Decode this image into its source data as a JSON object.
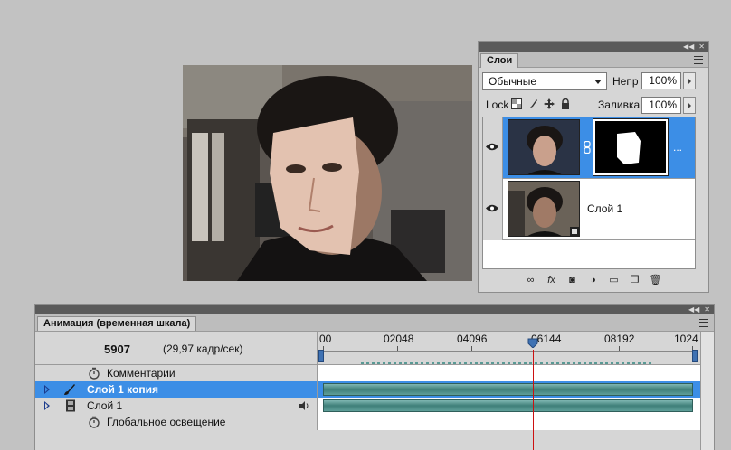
{
  "layers_panel": {
    "title": "Слои",
    "blend_mode": "Обычные",
    "opacity_label": "Непр",
    "opacity_value": "100%",
    "lock_label": "Lock",
    "fill_label": "Заливка",
    "fill_value": "100%",
    "layers": [
      {
        "name": "",
        "selected": true,
        "has_mask": true,
        "overflow_text": "..."
      },
      {
        "name": "Слой 1",
        "selected": false,
        "has_mask": false
      }
    ],
    "bottom_icons": [
      "link-layers-icon",
      "fx-icon",
      "add-mask-icon",
      "adjustment-icon",
      "group-folder-icon",
      "new-layer-icon",
      "trash-icon"
    ]
  },
  "animation_panel": {
    "title": "Анимация (временная шкала)",
    "current_frame": "5907",
    "fps": "(29,97 кадр/сек)",
    "ruler_labels": [
      "00",
      "02048",
      "04096",
      "06144",
      "08192",
      "1024"
    ],
    "playhead_frame": 6144,
    "tracks": [
      {
        "label": "Комментарии",
        "icon": "stopwatch-icon",
        "expandable": false,
        "selected": false,
        "has_bar": false
      },
      {
        "label": "Слой 1 копия",
        "icon": "brush-icon",
        "expandable": true,
        "selected": true,
        "has_bar": true
      },
      {
        "label": "Слой 1",
        "icon": "film-strip-icon",
        "expandable": true,
        "selected": false,
        "has_bar": true,
        "audio": true
      },
      {
        "label": "Глобальное освещение",
        "icon": "stopwatch-icon",
        "expandable": false,
        "selected": false,
        "has_bar": false
      }
    ]
  },
  "colors": {
    "selection": "#3c8ee6",
    "playhead": "#cc1111",
    "layer_bar": "#5f9f99",
    "background": "#c2c2c2"
  }
}
